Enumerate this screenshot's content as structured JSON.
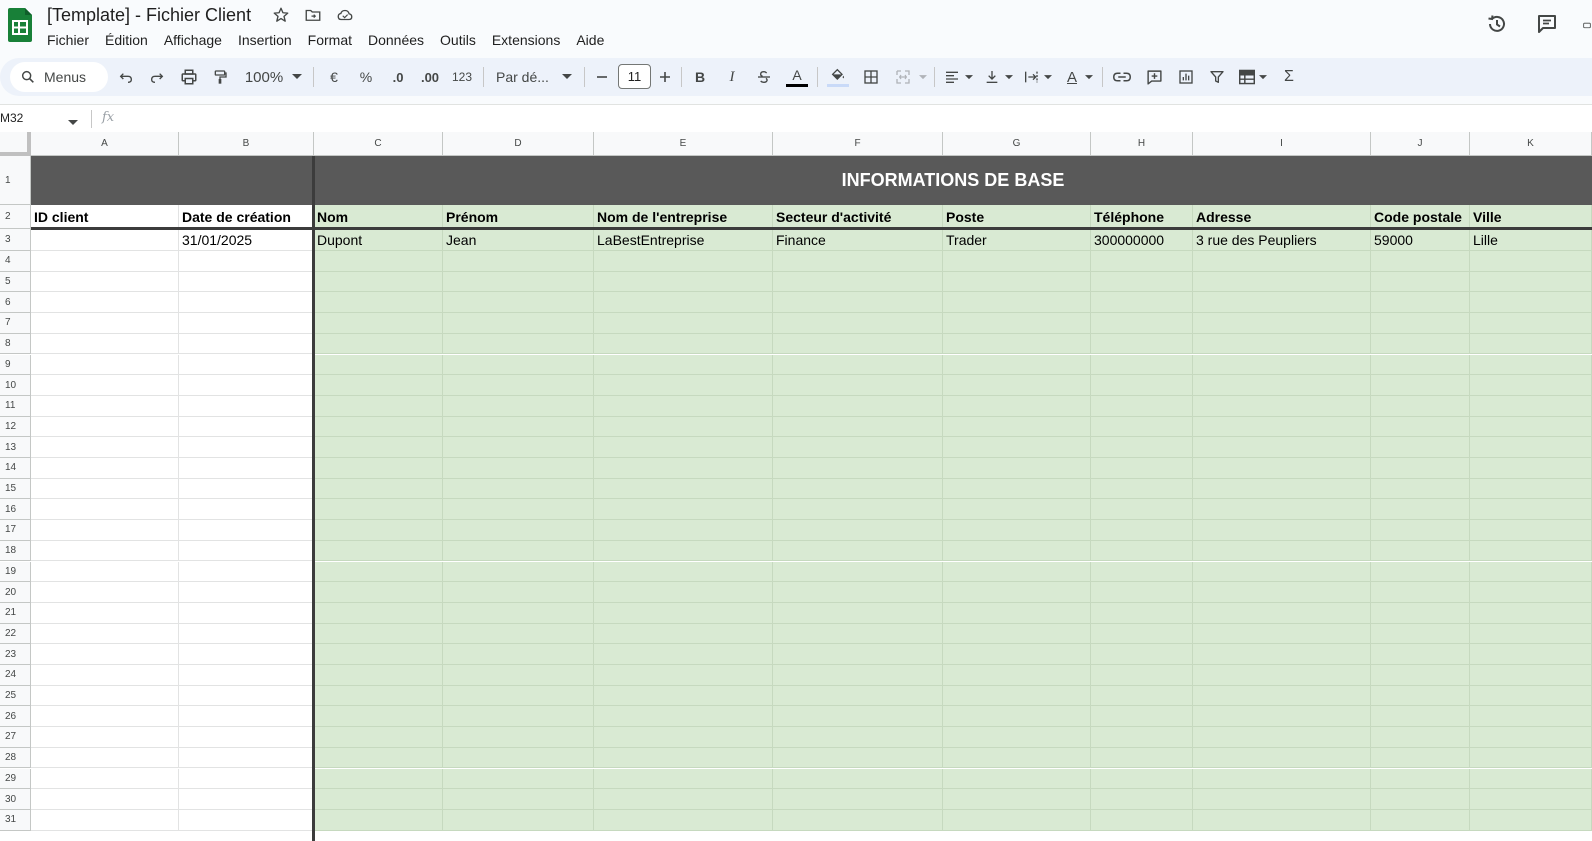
{
  "app": {
    "title": "[Template] - Fichier Client",
    "menu": [
      "Fichier",
      "Édition",
      "Affichage",
      "Insertion",
      "Format",
      "Données",
      "Outils",
      "Extensions",
      "Aide"
    ]
  },
  "toolbar": {
    "search_label": "Menus",
    "zoom": "100%",
    "currency": "€",
    "percent": "%",
    "decrease_decimals": ".0",
    "increase_decimals": ".00",
    "number_format": "123",
    "font_name": "Par dé...",
    "font_size": "11",
    "bold": "B",
    "italic": "I",
    "text_color_letter": "A",
    "text_rotate_letter": "A",
    "sum": "Σ"
  },
  "formula_bar": {
    "name_box": "M32",
    "fx": "fx",
    "value": ""
  },
  "columns": [
    "A",
    "B",
    "C",
    "D",
    "E",
    "F",
    "G",
    "H",
    "I",
    "J",
    "K"
  ],
  "rows": [
    "1",
    "2",
    "3",
    "4",
    "5",
    "6",
    "7",
    "8",
    "9",
    "10",
    "11",
    "12",
    "13",
    "14",
    "15",
    "16",
    "17",
    "18",
    "19",
    "20",
    "21",
    "22",
    "23",
    "24",
    "25",
    "26",
    "27",
    "28",
    "29",
    "30",
    "31"
  ],
  "sheet": {
    "banner": "INFORMATIONS DE BASE",
    "headers": [
      "ID client",
      "Date de création",
      "Nom",
      "Prénom",
      "Nom de l'entreprise",
      "Secteur d'activité",
      "Poste",
      "Téléphone",
      "Adresse",
      "Code postale",
      "Ville"
    ],
    "row3": [
      "",
      "31/01/2025",
      "Dupont",
      "Jean",
      "LaBestEntreprise",
      "Finance",
      "Trader",
      "300000000",
      "3 rue des Peupliers",
      "59000",
      "Lille"
    ]
  },
  "colors": {
    "banner_bg": "#595959",
    "data_bg": "#d9ead3",
    "sheets_green": "#188038"
  },
  "icons": [
    "sheets-logo-icon",
    "star-icon",
    "move-folder-icon",
    "cloud-status-icon",
    "history-icon",
    "comments-icon",
    "search-icon",
    "undo-icon",
    "redo-icon",
    "print-icon",
    "paint-format-icon",
    "fill-color-icon",
    "borders-icon",
    "merge-cells-icon",
    "align-icon",
    "valign-icon",
    "wrap-icon",
    "link-icon",
    "comment-add-icon",
    "chart-icon",
    "filter-icon",
    "table-icon"
  ]
}
